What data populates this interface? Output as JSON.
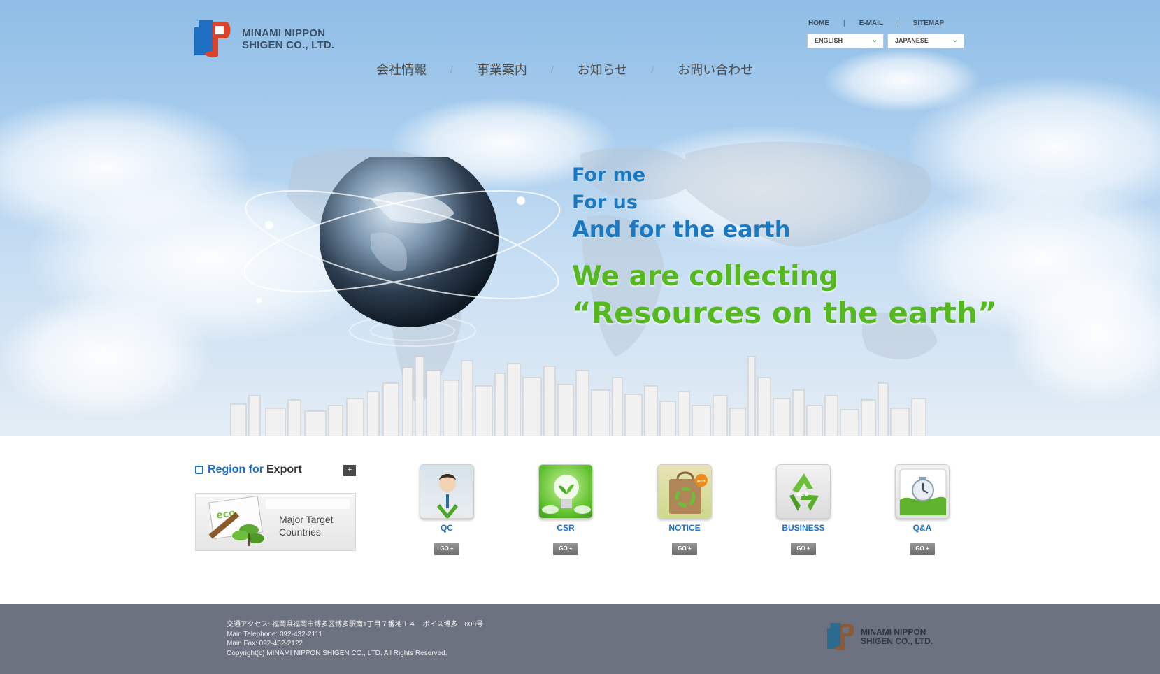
{
  "header": {
    "logo_text_line1": "MINAMI NIPPON",
    "logo_text_line2": "SHIGEN CO., LTD.",
    "util_nav": [
      "HOME",
      "E-MAIL",
      "SITEMAP"
    ],
    "lang_english": "ENGLISH",
    "lang_japanese": "JAPANESE",
    "main_nav": [
      "会社情報",
      "事業案内",
      "お知らせ",
      "お問い合わせ"
    ]
  },
  "hero": {
    "line1": "For me",
    "line2": "For us",
    "line3": "And for the earth",
    "line4": "We are collecting",
    "line5": "“Resources on the earth”"
  },
  "region": {
    "title_blue": "Region for",
    "title_dark": "Export",
    "plus": "+",
    "card_line1": "Major Target",
    "card_line2": "Countries"
  },
  "features": [
    {
      "label": "QC",
      "go": "GO +",
      "icon": "person-icon"
    },
    {
      "label": "CSR",
      "go": "GO +",
      "icon": "lightbulb-icon"
    },
    {
      "label": "NOTICE",
      "go": "GO +",
      "icon": "eco-bag-icon"
    },
    {
      "label": "BUSINESS",
      "go": "GO +",
      "icon": "recycle-icon"
    },
    {
      "label": "Q&A",
      "go": "GO +",
      "icon": "clock-icon"
    }
  ],
  "footer": {
    "address": "交通アクセス: 福岡県福岡市博多区博多駅南1丁目７番地１４　ボイス博多　608号",
    "tel": "Main Telephone: 092-432-2111",
    "fax": "Main Fax: 092-432-2122",
    "copyright": "Copyright(c) MINAMI NIPPON SHIGEN CO., LTD. All Rights Reserved.",
    "logo_line1": "MINAMI NIPPON",
    "logo_line2": "SHIGEN CO., LTD."
  },
  "colors": {
    "brand_blue": "#1e6fc1",
    "brand_red": "#d9442b",
    "accent_green": "#56b81f",
    "footer_bg": "#6d7280"
  }
}
